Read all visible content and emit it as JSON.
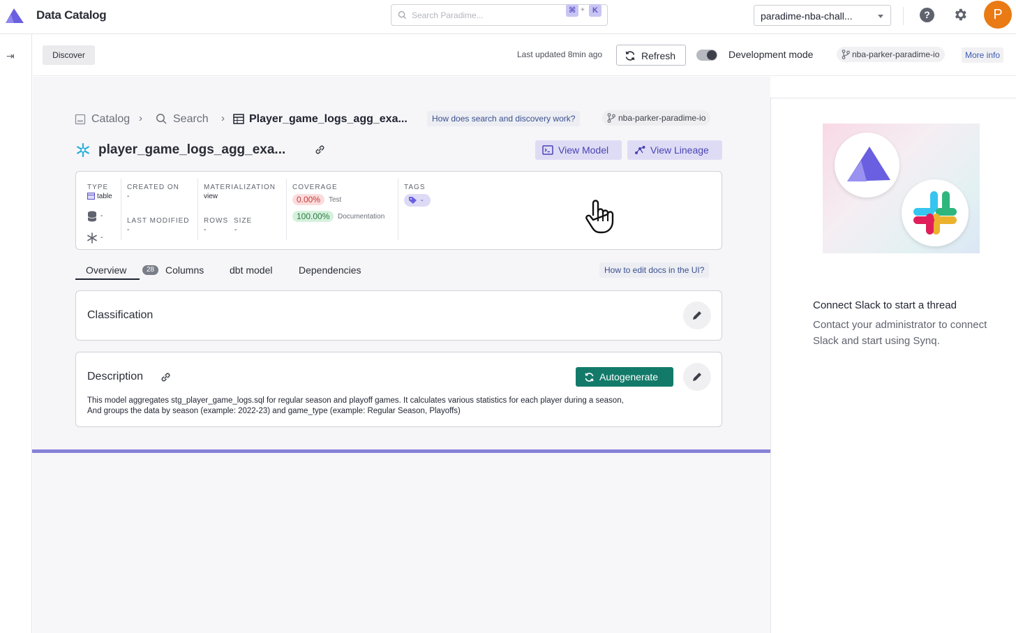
{
  "app": {
    "title": "Data Catalog"
  },
  "search": {
    "placeholder": "Search Paradime...",
    "shortcut_key1": "⌘",
    "shortcut_plus": "+",
    "shortcut_key2": "K"
  },
  "workspace": {
    "selected": "paradime-nba-chall..."
  },
  "user": {
    "avatar_initial": "P"
  },
  "help_glyph": "?",
  "subbar": {
    "tab": "Discover",
    "last_updated": "Last updated 8min ago",
    "refresh_label": "Refresh",
    "dev_mode_label": "Development mode",
    "dev_mode_on": true,
    "branch": "nba-parker-paradime-io",
    "more_info": "More info"
  },
  "breadcrumb": {
    "catalog": "Catalog",
    "search": "Search",
    "current": "Player_game_logs_agg_exa..."
  },
  "help_link": "How does search and discovery work?",
  "branch_chip": "nba-parker-paradime-io",
  "model": {
    "title": "player_game_logs_agg_exa...",
    "view_model": "View Model",
    "view_lineage": "View Lineage"
  },
  "meta": {
    "type_label": "TYPE",
    "type_value": "table",
    "db_value": "-",
    "schema_value": "-",
    "created_label": "CREATED ON",
    "created_value": "-",
    "modified_label": "LAST MODIFIED",
    "modified_value": "-",
    "materialization_label": "MATERIALIZATION",
    "materialization_value": "view",
    "rows_label": "ROWS",
    "rows_value": "-",
    "size_label": "SIZE",
    "size_value": "-",
    "coverage_label": "COVERAGE",
    "coverage_test_value": "0.00%",
    "coverage_test_label": "Test",
    "coverage_doc_value": "100.00%",
    "coverage_doc_label": "Documentation",
    "tags_label": "TAGS",
    "tags_value": "-"
  },
  "tabs": {
    "overview": "Overview",
    "columns_count": "28",
    "columns": "Columns",
    "dbt_model": "dbt model",
    "dependencies": "Dependencies"
  },
  "edit_docs_link": "How to edit docs in the UI?",
  "classification": {
    "title": "Classification"
  },
  "description": {
    "title": "Description",
    "autogenerate": "Autogenerate",
    "line1": "This model aggregates stg_player_game_logs.sql for regular season and playoff games. It calculates various statistics for each player during a season,",
    "line2": "And groups the data by season (example: 2022-23) and game_type (example: Regular Season, Playoffs)"
  },
  "slack_panel": {
    "title": "Connect Slack to start a thread",
    "body": "Contact your administrator to connect Slack and start using Synq."
  },
  "colors": {
    "accent": "#6c5ce7",
    "autogenerate": "#137a6a",
    "avatar": "#ea7a14",
    "progress": "#8782d8"
  }
}
